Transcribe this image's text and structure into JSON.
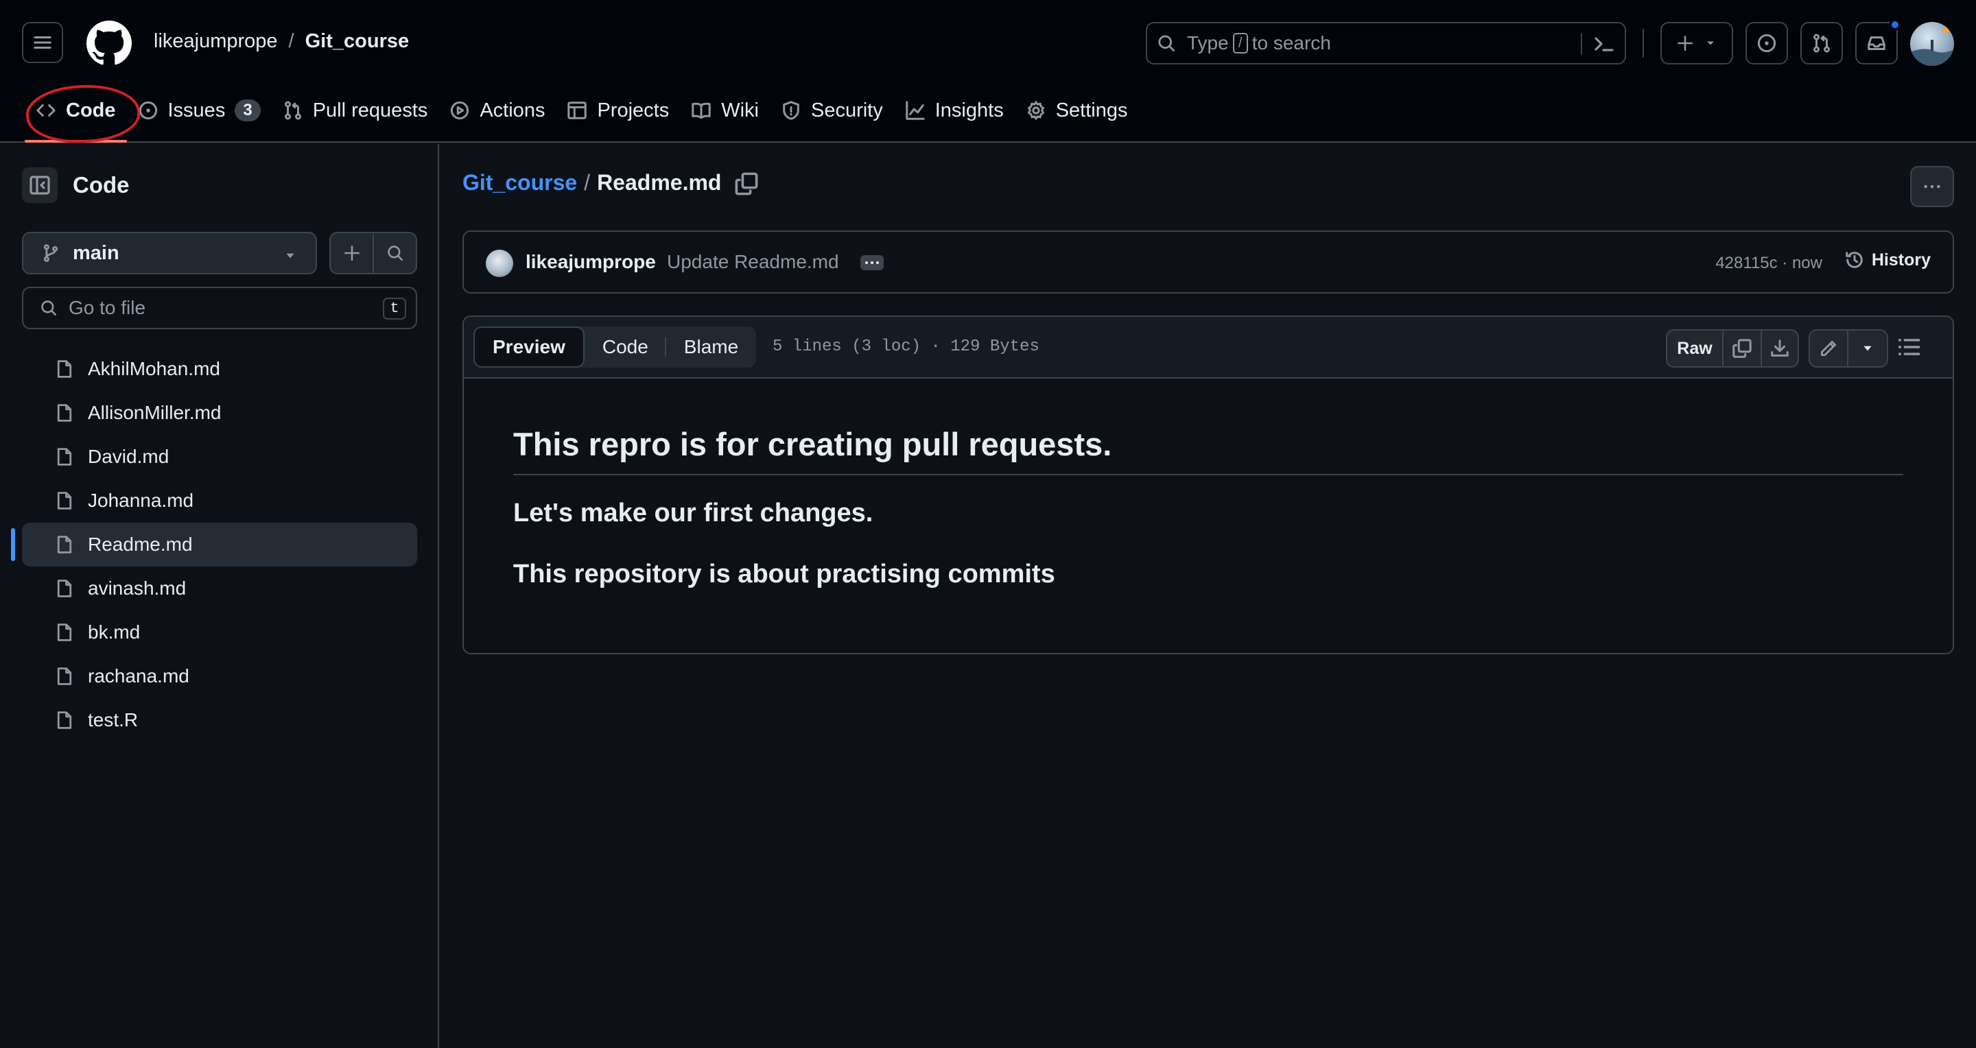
{
  "header": {
    "owner": "likeajumprope",
    "separator": "/",
    "repo": "Git_course",
    "search": {
      "prefix": "Type",
      "key": "/",
      "suffix": "to search"
    }
  },
  "repo_nav": {
    "items": [
      {
        "label": "Code",
        "icon": "code-icon",
        "active": true
      },
      {
        "label": "Issues",
        "icon": "issue-opened-icon",
        "count": "3"
      },
      {
        "label": "Pull requests",
        "icon": "git-pull-request-icon"
      },
      {
        "label": "Actions",
        "icon": "play-icon"
      },
      {
        "label": "Projects",
        "icon": "table-icon"
      },
      {
        "label": "Wiki",
        "icon": "book-icon"
      },
      {
        "label": "Security",
        "icon": "shield-icon"
      },
      {
        "label": "Insights",
        "icon": "graph-icon"
      },
      {
        "label": "Settings",
        "icon": "gear-icon"
      }
    ]
  },
  "sidebar": {
    "title": "Code",
    "branch": "main",
    "goto_placeholder": "Go to file",
    "goto_key": "t",
    "files": [
      {
        "name": "AkhilMohan.md"
      },
      {
        "name": "AllisonMiller.md"
      },
      {
        "name": "David.md"
      },
      {
        "name": "Johanna.md"
      },
      {
        "name": "Readme.md",
        "selected": true
      },
      {
        "name": "avinash.md"
      },
      {
        "name": "bk.md"
      },
      {
        "name": "rachana.md"
      },
      {
        "name": "test.R"
      }
    ]
  },
  "main": {
    "breadcrumb_repo": "Git_course",
    "breadcrumb_sep": "/",
    "breadcrumb_file": "Readme.md",
    "commit": {
      "author": "likeajumprope",
      "message": "Update Readme.md",
      "sha_time": "428115c · now",
      "history_label": "History"
    },
    "file_view": {
      "tabs": [
        "Preview",
        "Code",
        "Blame"
      ],
      "active_tab": "Preview",
      "meta": "5 lines (3 loc) · 129 Bytes",
      "raw_label": "Raw"
    },
    "markdown": {
      "h1": "This repro is for creating pull requests.",
      "h2_a": "Let's make our first changes.",
      "h2_b": "This repository is about practising commits"
    }
  },
  "colors": {
    "background": "#0d1117",
    "header_bg": "#010409",
    "link": "#4493f8",
    "annotation": "#d42027",
    "active_underline": "#f78166"
  }
}
